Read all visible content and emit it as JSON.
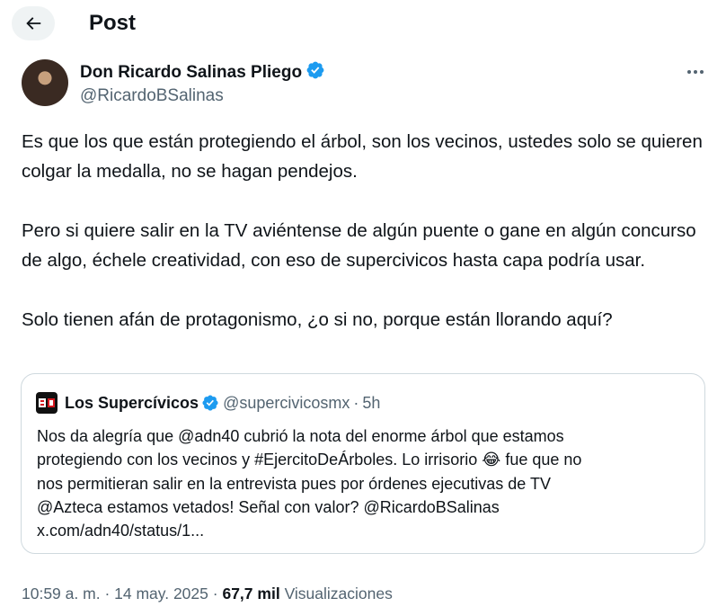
{
  "header": {
    "title": "Post"
  },
  "author": {
    "name": "Don Ricardo Salinas Pliego",
    "handle": "@RicardoBSalinas"
  },
  "tweet": {
    "paragraphs": [
      "Es que los que están protegiendo el árbol, son los vecinos, ustedes solo se quieren colgar la medalla, no se hagan pendejos.",
      "Pero si quiere salir en la TV aviéntense de algún puente o gane en algún concurso de algo, échele creatividad, con eso de supercivicos hasta capa podría usar.",
      "Solo tienen afán de protagonismo, ¿o si no, porque están llorando aquí?"
    ]
  },
  "quote": {
    "name": "Los Supercívicos",
    "handle": "@supercivicosmx",
    "separator": "·",
    "time": "5h",
    "lines": [
      "Nos da alegría que @adn40 cubrió la nota del enorme árbol que estamos",
      "protegiendo con los vecinos y  #EjercitoDeÁrboles. Lo irrisorio",
      "fue que no",
      "nos permitieran salir en la entrevista pues por órdenes ejecutivas de TV",
      "@Azteca estamos vetados! Señal con valor? @RicardoBSalinas",
      "x.com/adn40/status/1..."
    ],
    "emoji": "😂"
  },
  "footer": {
    "time": "10:59 a. m.",
    "sep1": "·",
    "date": "14 may. 2025",
    "sep2": "·",
    "views_count": "67,7 mil",
    "views_label": "Visualizaciones"
  },
  "icons": {
    "back": "arrow-left-icon",
    "verified": "verified-badge-icon",
    "more": "more-horizontal-icon",
    "quote_logo": "supercivicos-logo-icon"
  },
  "colors": {
    "verified": "#1d9bf0",
    "text": "#0f1419",
    "secondary": "#536471",
    "border": "#cfd9de"
  }
}
